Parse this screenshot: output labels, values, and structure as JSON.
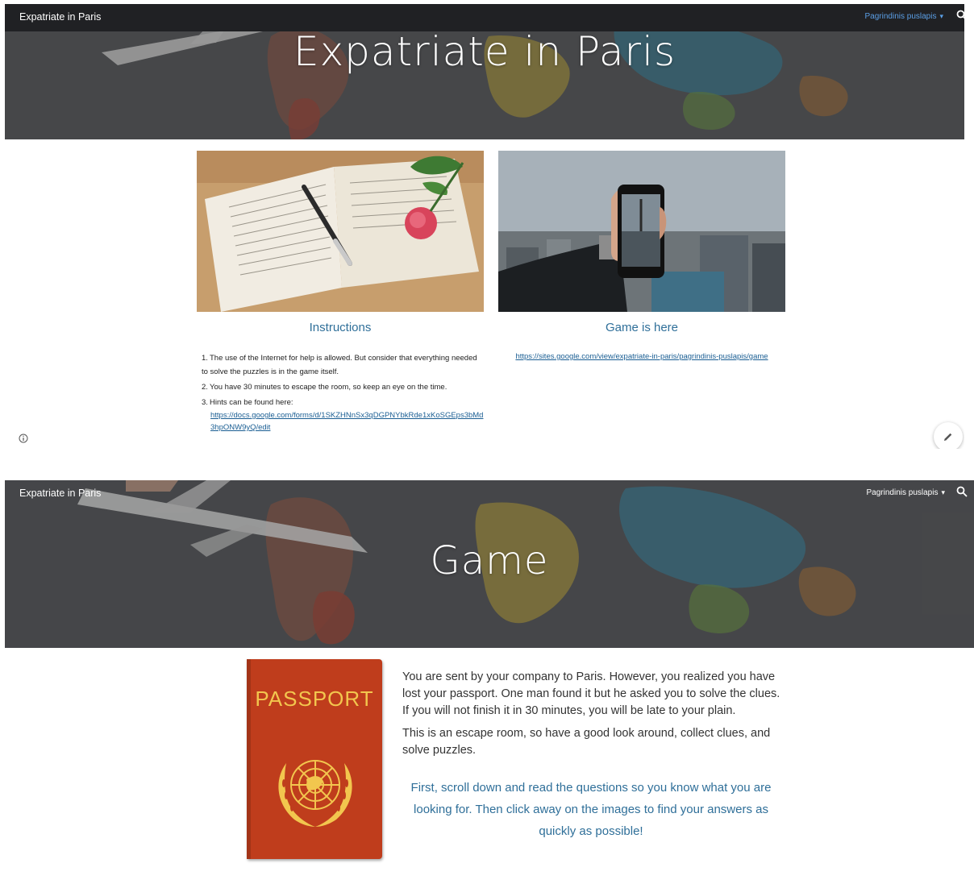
{
  "screen1": {
    "site_title": "Expatriate in Paris",
    "nav_label": "Pagrindinis puslapis",
    "hero_title": "Expatriate in Paris",
    "cards": {
      "instructions": {
        "heading": "Instructions",
        "items": [
          "The use of the Internet for help is allowed. But consider that everything needed to solve the puzzles is in the game itself.",
          "You have 30 minutes to escape the room, so keep an eye on the time.",
          "Hints can be found here:"
        ],
        "hint_link": "https://docs.google.com/forms/d/1SKZHNnSx3qDGPNYbkRde1xKoSGEps3bMd3hpONW9yQ/edit"
      },
      "game": {
        "heading": "Game is here",
        "link": "https://sites.google.com/view/expatriate-in-paris/pagrindinis-puslapis/game"
      }
    }
  },
  "screen2": {
    "site_title": "Expatriate in Paris",
    "nav_label": "Pagrindinis puslapis",
    "hero_title": "Game",
    "passport_label": "PASSPORT",
    "story": [
      "You are sent by your company to Paris. However, you realized you have lost your passport. One man found it but he asked you to solve the clues. If you will not finish it in 30 minutes, you will be late to your plain.",
      "This is an escape room, so have a good look around, collect clues, and solve puzzles."
    ],
    "callout": "First, scroll down and read the questions so you know what you are looking for. Then click away on the images to find your answers as quickly as possible!"
  },
  "colors": {
    "accent": "#2f6f99",
    "link": "#1a5e93",
    "topbar": "#202124",
    "passport": "#bf3d1c",
    "passport_text": "#f2c64e"
  },
  "icons": [
    "search-icon",
    "chevron-down-icon",
    "info-icon",
    "pencil-icon",
    "un-emblem-icon"
  ]
}
